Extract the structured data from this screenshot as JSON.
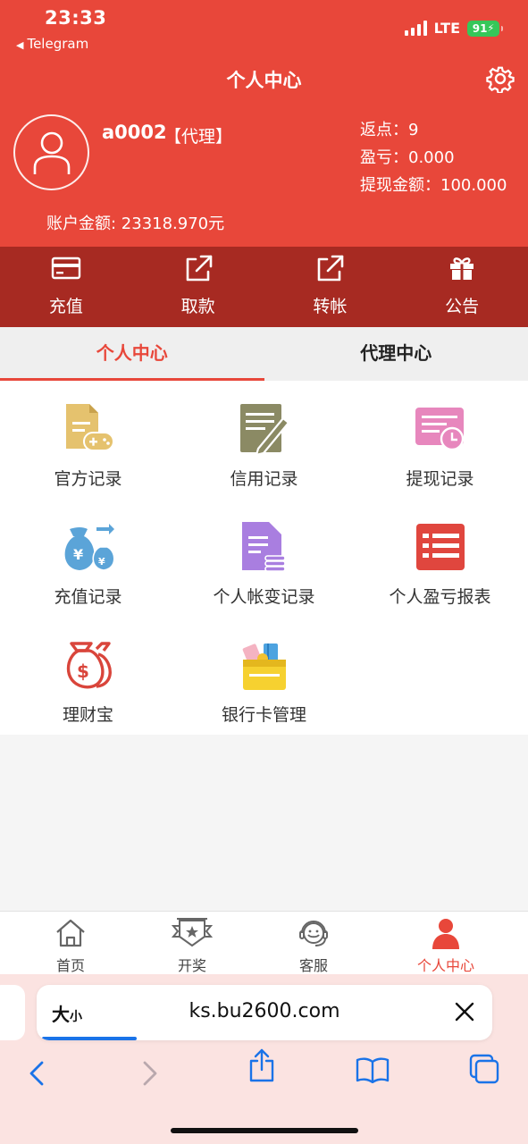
{
  "status_bar": {
    "time": "23:33",
    "back_app": "Telegram",
    "network": "LTE",
    "battery": "91"
  },
  "header": {
    "title": "个人中心",
    "username": "a0002",
    "role": "【代理】",
    "rebate": "返点：9",
    "profit": "盈亏：0.000",
    "withdraw_amount": "提现金额：100.000",
    "balance": "账户金额: 23318.970元"
  },
  "actions": [
    {
      "label": "充值",
      "icon": "card-icon"
    },
    {
      "label": "取款",
      "icon": "external-link-icon"
    },
    {
      "label": "转帐",
      "icon": "external-link-icon"
    },
    {
      "label": "公告",
      "icon": "gift-icon"
    }
  ],
  "tabs": [
    {
      "label": "个人中心",
      "active": true
    },
    {
      "label": "代理中心",
      "active": false
    }
  ],
  "grid": [
    {
      "label": "官方记录",
      "icon": "document-gamepad-icon"
    },
    {
      "label": "信用记录",
      "icon": "document-pen-icon"
    },
    {
      "label": "提现记录",
      "icon": "document-clock-icon"
    },
    {
      "label": "充值记录",
      "icon": "money-bags-icon"
    },
    {
      "label": "个人帐变记录",
      "icon": "document-coins-icon"
    },
    {
      "label": "个人盈亏报表",
      "icon": "list-table-icon"
    },
    {
      "label": "理财宝",
      "icon": "dollar-bags-icon"
    },
    {
      "label": "银行卡管理",
      "icon": "wallet-cards-icon"
    }
  ],
  "bottom_nav": [
    {
      "label": "首页",
      "icon": "home-icon",
      "active": false
    },
    {
      "label": "开奖",
      "icon": "badge-star-icon",
      "active": false
    },
    {
      "label": "客服",
      "icon": "support-agent-icon",
      "active": false
    },
    {
      "label": "个人中心",
      "icon": "person-icon",
      "active": true
    }
  ],
  "browser": {
    "text_size_label_big": "大",
    "text_size_label_small": "小",
    "url": "ks.bu2600.com"
  },
  "colors": {
    "primary_red": "#e8473a",
    "dark_red": "#a72a22",
    "tab_bg": "#efefef",
    "link_blue": "#1a73e8"
  }
}
